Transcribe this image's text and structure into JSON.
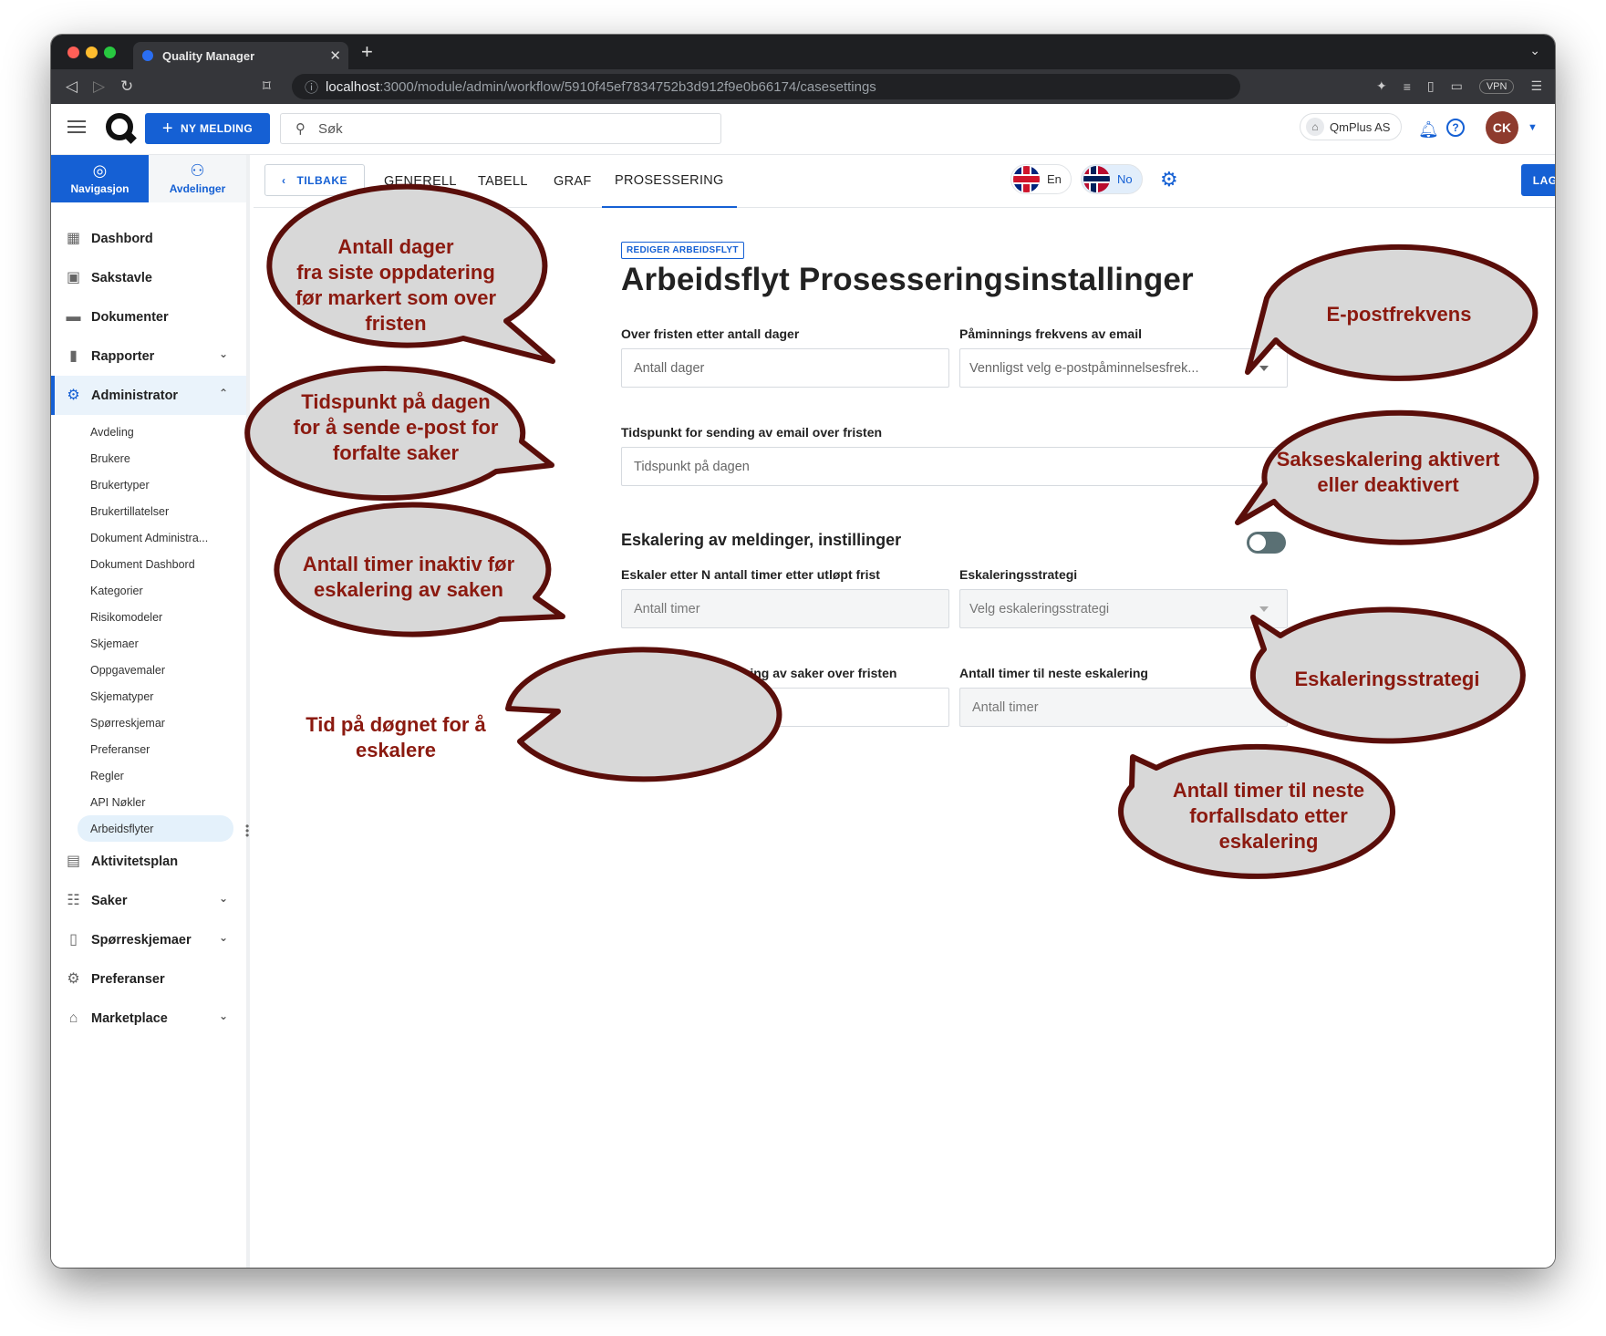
{
  "browser": {
    "tab_title": "Quality Manager",
    "url_host": "localhost",
    "url_path": ":3000/module/admin/workflow/5910f45ef7834752b3d912f9e0b66174/casesettings",
    "vpn": "VPN"
  },
  "header": {
    "new_message": "NY MELDING",
    "search_placeholder": "Søk",
    "org": "QmPlus AS",
    "avatar_initials": "CK"
  },
  "sidebar": {
    "tabs": [
      {
        "label": "Navigasjon",
        "icon": "compass-icon"
      },
      {
        "label": "Avdelinger",
        "icon": "org-chart-icon"
      }
    ],
    "items": [
      {
        "label": "Dashbord",
        "icon": "dashboard-icon"
      },
      {
        "label": "Sakstavle",
        "icon": "board-icon"
      },
      {
        "label": "Dokumenter",
        "icon": "folder-icon"
      },
      {
        "label": "Rapporter",
        "icon": "chart-icon"
      },
      {
        "label": "Administrator",
        "icon": "admin-gear-icon"
      },
      {
        "label": "Aktivitetsplan",
        "icon": "calendar-icon"
      },
      {
        "label": "Saker",
        "icon": "cases-icon"
      },
      {
        "label": "Spørreskjemaer",
        "icon": "clipboard-icon"
      },
      {
        "label": "Preferanser",
        "icon": "gear-icon"
      },
      {
        "label": "Marketplace",
        "icon": "store-icon"
      }
    ],
    "admin_sub": [
      "Avdeling",
      "Brukere",
      "Brukertyper",
      "Brukertillatelser",
      "Dokument Administra...",
      "Dokument Dashbord",
      "Kategorier",
      "Risikomodeler",
      "Skjemaer",
      "Oppgavemaler",
      "Skjematyper",
      "Spørreskjemar",
      "Preferanser",
      "Regler",
      "API Nøkler",
      "Arbeidsflyter"
    ]
  },
  "content": {
    "back": "TILBAKE",
    "tabs": [
      "GENERELL",
      "TABELL",
      "GRAF",
      "PROSESSERING"
    ],
    "lang_en": "En",
    "lang_no": "No",
    "save": "LAGRE",
    "badge": "REDIGER ARBEIDSFLYT",
    "title": "Arbeidsflyt Prosesseringsinstallinger",
    "fields": {
      "overdue_days_label": "Over fristen etter antall dager",
      "overdue_days_placeholder": "Antall dager",
      "reminder_freq_label": "Påminnings frekvens av email",
      "reminder_freq_placeholder": "Vennligst velg e-postpåminnelsesfrek...",
      "send_time_label": "Tidspunkt for sending av email over fristen",
      "send_time_placeholder": "Tidspunkt på dagen",
      "escalation_section": "Eskalering av meldinger, instillinger",
      "escalate_hours_label": "Eskaler etter N antall timer etter utløpt frist",
      "escalate_hours_placeholder": "Antall timer",
      "strategy_label": "Eskaleringsstrategi",
      "strategy_placeholder": "Velg eskaleringsstrategi",
      "escalate_time_label": "Tidspunkt for eskalering av saker over fristen",
      "escalate_time_placeholder": "Tidspunkt på dagen",
      "next_escalation_label": "Antall timer til neste eskalering",
      "next_escalation_placeholder": "Antall timer"
    }
  },
  "callouts": {
    "c1": [
      "Antall dager",
      "fra siste oppdatering",
      "før markert som over",
      "fristen"
    ],
    "c2": [
      "Tidspunkt på dagen",
      "for å sende e-post for",
      "forfalte saker"
    ],
    "c3": [
      "Antall timer inaktiv før",
      "eskalering av saken"
    ],
    "c4": [
      "Tid på døgnet for å",
      "eskalere"
    ],
    "c5": [
      "E-postfrekvens"
    ],
    "c6": [
      "Sakseskalering aktivert",
      "eller deaktivert"
    ],
    "c7": [
      "Eskaleringsstrategi"
    ],
    "c8": [
      "Antall timer til neste",
      "forfallsdato etter",
      "eskalering"
    ]
  },
  "colors": {
    "accent": "#1560d4",
    "callout_fill": "#d8d8d8",
    "callout_stroke": "#5a0e0a",
    "callout_text": "#8b1a10"
  }
}
